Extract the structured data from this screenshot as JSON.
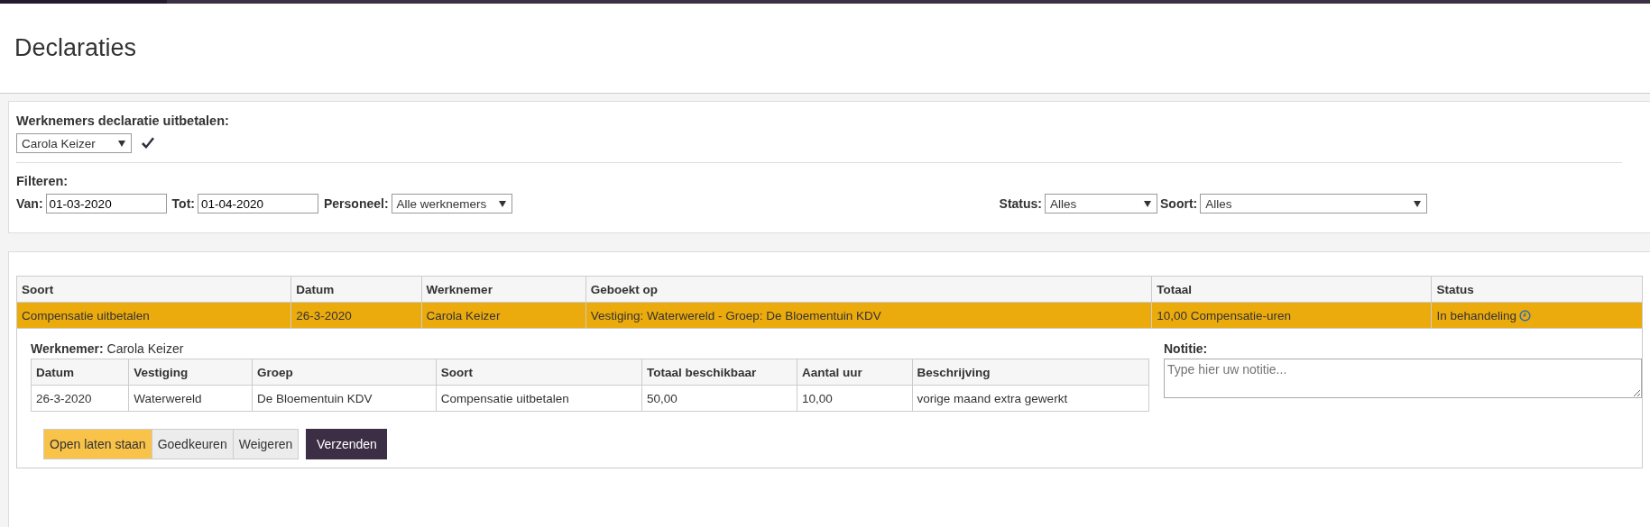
{
  "page_title": "Declaraties",
  "payout": {
    "label": "Werknemers declaratie uitbetalen:",
    "employee_select": "Carola Keizer"
  },
  "filters": {
    "label": "Filteren:",
    "from_label": "Van:",
    "from_value": "01-03-2020",
    "to_label": "Tot:",
    "to_value": "01-04-2020",
    "staff_label": "Personeel:",
    "staff_select": "Alle werknemers",
    "status_label": "Status:",
    "status_select": "Alles",
    "type_label": "Soort:",
    "type_select": "Alles"
  },
  "table": {
    "columns": [
      "Soort",
      "Datum",
      "Werknemer",
      "Geboekt op",
      "Totaal",
      "Status"
    ],
    "rows": [
      {
        "cells": [
          "Compensatie uitbetalen",
          "26-3-2020",
          "Carola Keizer",
          "Vestiging: Waterwereld - Groep: De Bloementuin KDV",
          "10,00 Compensatie-uren",
          "In behandeling"
        ],
        "selected": true
      }
    ]
  },
  "detail": {
    "employee_label": "Werknemer:",
    "employee_name": "Carola Keizer",
    "columns": [
      "Datum",
      "Vestiging",
      "Groep",
      "Soort",
      "Totaal beschikbaar",
      "Aantal uur",
      "Beschrijving"
    ],
    "rows": [
      [
        "26-3-2020",
        "Waterwereld",
        "De Bloementuin KDV",
        "Compensatie uitbetalen",
        "50,00",
        "10,00",
        "vorige maand extra gewerkt"
      ]
    ],
    "note_label": "Notitie:",
    "note_placeholder": "Type hier uw notitie...",
    "decision_buttons": [
      {
        "label": "Open laten staan",
        "selected": true
      },
      {
        "label": "Goedkeuren",
        "selected": false
      },
      {
        "label": "Weigeren",
        "selected": false
      }
    ],
    "submit_button": "Verzenden"
  }
}
